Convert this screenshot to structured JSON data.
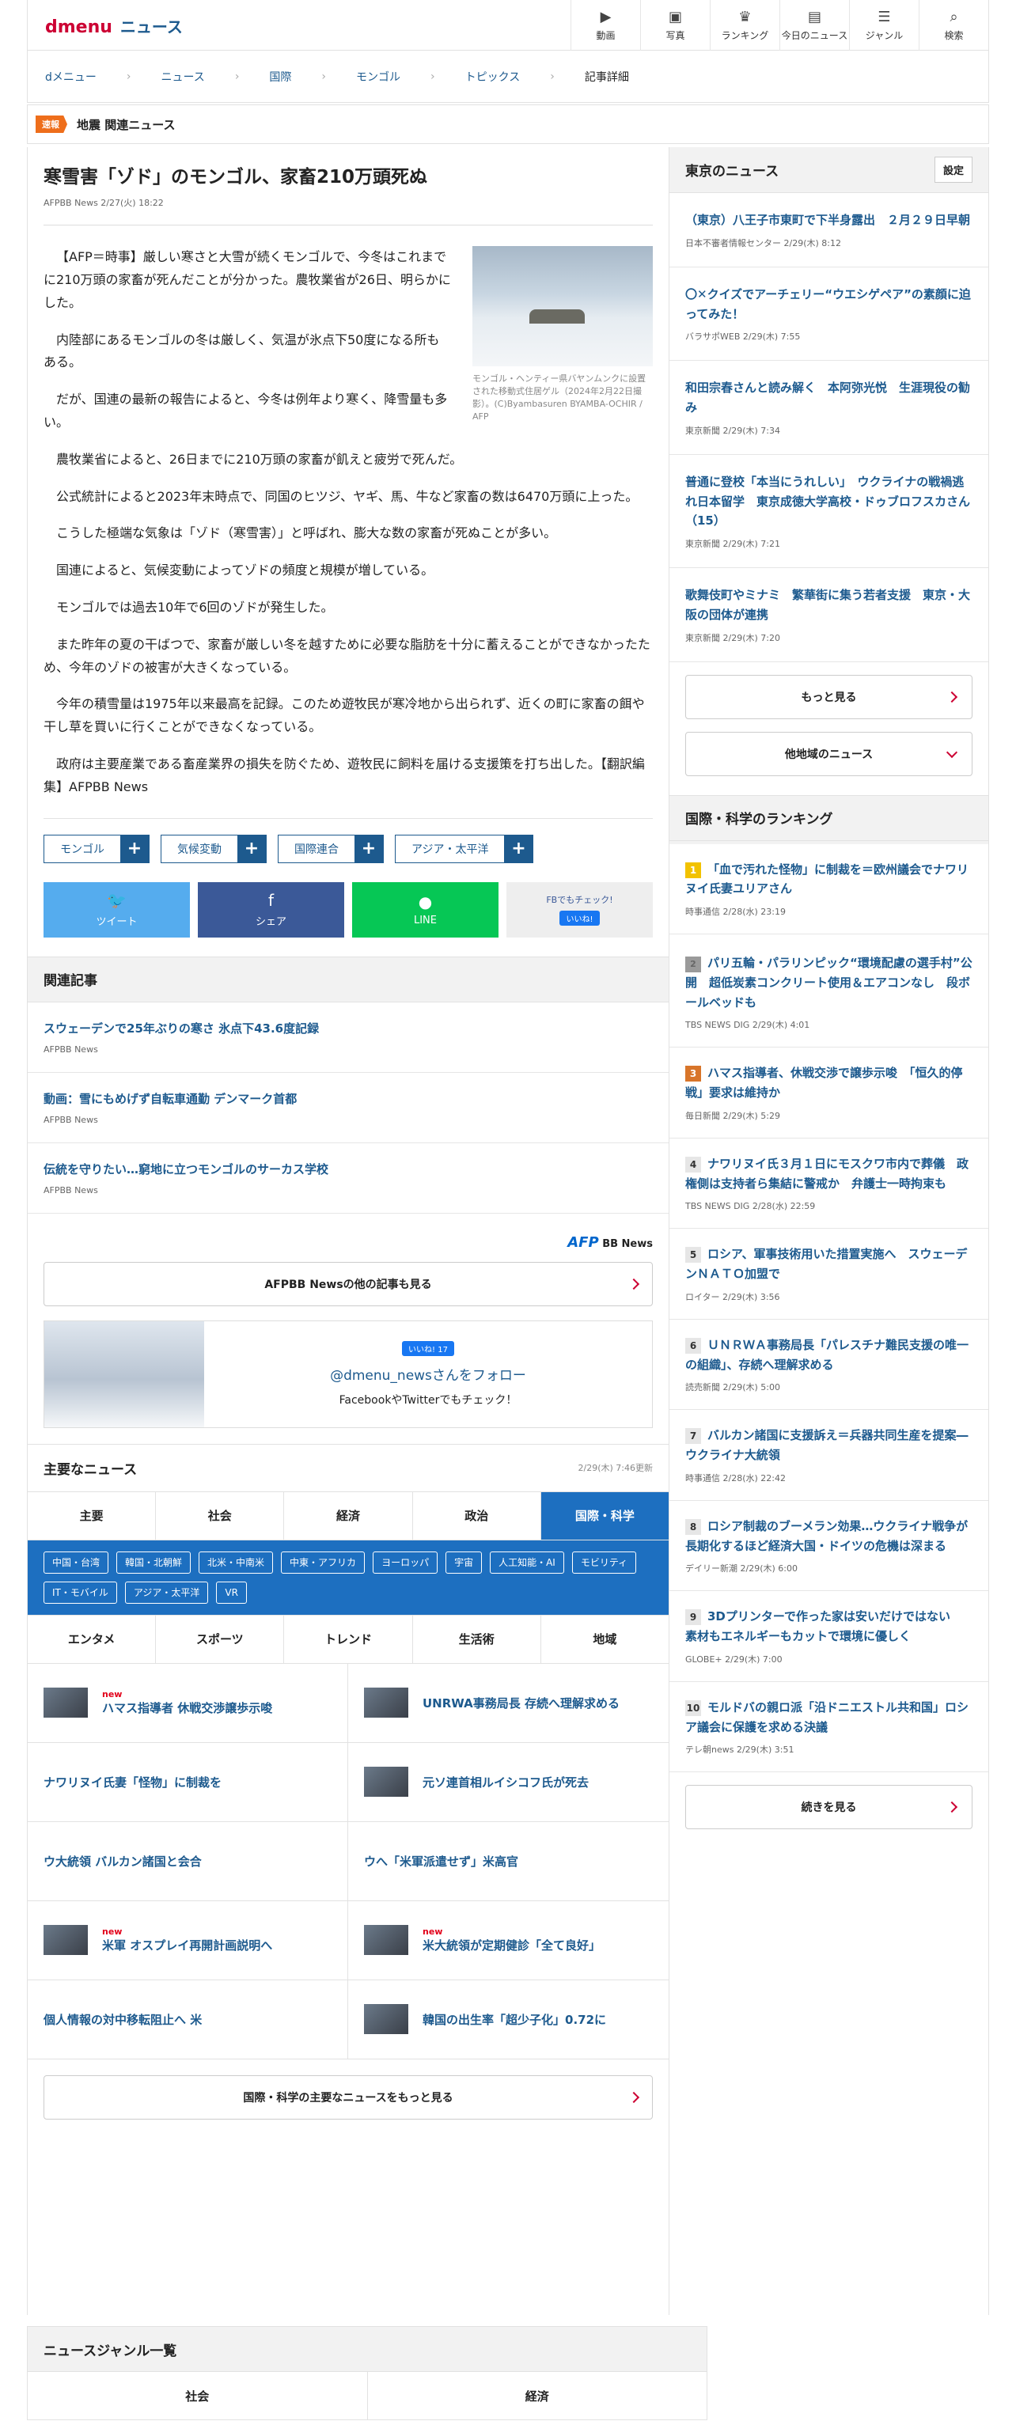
{
  "header": {
    "logo_d": "dmenu",
    "logo_news": "ニュース",
    "nav": [
      {
        "icon": "video-icon",
        "glyph": "▶",
        "label": "動画"
      },
      {
        "icon": "photo-icon",
        "glyph": "▣",
        "label": "写真"
      },
      {
        "icon": "ranking-icon",
        "glyph": "♛",
        "label": "ランキング"
      },
      {
        "icon": "today-icon",
        "glyph": "▤",
        "label": "今日のニュース"
      },
      {
        "icon": "genre-icon",
        "glyph": "☰",
        "label": "ジャンル"
      },
      {
        "icon": "search-icon",
        "glyph": "⌕",
        "label": "検索"
      }
    ]
  },
  "breadcrumb": [
    "dメニュー",
    "ニュース",
    "国際",
    "モンゴル",
    "トピックス",
    "記事詳細"
  ],
  "alert": {
    "badge": "速報",
    "text": "地震 関連ニュース"
  },
  "article": {
    "title": "寒雪害「ゾド」のモンゴル、家畜210万頭死ぬ",
    "meta": "AFPBB News 2/27(火) 18:22",
    "caption": "モンゴル・ヘンティー県バヤンムンクに設置された移動式住居ゲル（2024年2月22日撮影）。(C)Byambasuren BYAMBA-OCHIR / AFP",
    "paragraphs": [
      "【AFP＝時事】厳しい寒さと大雪が続くモンゴルで、今冬はこれまでに210万頭の家畜が死んだことが分かった。農牧業省が26日、明らかにした。",
      "内陸部にあるモンゴルの冬は厳しく、気温が氷点下50度になる所もある。",
      "だが、国連の最新の報告によると、今冬は例年より寒く、降雪量も多い。",
      "農牧業省によると、26日までに210万頭の家畜が飢えと疲労で死んだ。",
      "公式統計によると2023年末時点で、同国のヒツジ、ヤギ、馬、牛など家畜の数は6470万頭に上った。",
      "こうした極端な気象は「ゾド（寒雪害）」と呼ばれ、膨大な数の家畜が死ぬことが多い。",
      "国連によると、気候変動によってゾドの頻度と規模が増している。",
      "モンゴルでは過去10年で6回のゾドが発生した。",
      "また昨年の夏の干ばつで、家畜が厳しい冬を越すために必要な脂肪を十分に蓄えることができなかったため、今年のゾドの被害が大きくなっている。",
      "今年の積雪量は1975年以来最高を記録。このため遊牧民が寒冷地から出られず、近くの町に家畜の餌や干し草を買いに行くことができなくなっている。",
      "政府は主要産業である畜産業界の損失を防ぐため、遊牧民に飼料を届ける支援策を打ち出した。【翻訳編集】AFPBB News"
    ],
    "tags": [
      "モンゴル",
      "気候変動",
      "国際連合",
      "アジア・太平洋"
    ],
    "share": {
      "tweet": "ツイート",
      "share": "シェア",
      "line": "LINE",
      "fbcheck": "FBでもチェック!",
      "like": "いいね!"
    }
  },
  "related": {
    "heading": "関連記事",
    "items": [
      {
        "title": "スウェーデンで25年ぶりの寒さ 氷点下43.6度記録",
        "source": "AFPBB News"
      },
      {
        "title": "動画：雪にもめげず自転車通勤 デンマーク首都",
        "source": "AFPBB News"
      },
      {
        "title": "伝統を守りたい…窮地に立つモンゴルのサーカス学校",
        "source": "AFPBB News"
      }
    ],
    "afp_logo": "AFP",
    "afp_bb": "BB News",
    "more": "AFPBB Newsの他の記事も見る",
    "follow_like": "いいね! 17",
    "follow_handle": "@dmenu_newsさんをフォロー",
    "follow_sub": "FacebookやTwitterでもチェック！"
  },
  "main_news": {
    "heading": "主要なニュース",
    "updated": "2/29(木) 7:46更新",
    "tabs_top": [
      "主要",
      "社会",
      "経済",
      "政治",
      "国際・科学"
    ],
    "subcats": [
      "中国・台湾",
      "韓国・北朝鮮",
      "北米・中南米",
      "中東・アフリカ",
      "ヨーロッパ",
      "宇宙",
      "人工知能・AI",
      "モビリティ",
      "IT・モバイル",
      "アジア・太平洋",
      "VR"
    ],
    "tabs_bottom": [
      "エンタメ",
      "スポーツ",
      "トレンド",
      "生活術",
      "地域"
    ],
    "items": [
      {
        "title": "ハマス指導者 休戦交渉譲歩示唆",
        "new": "new",
        "thumb": true
      },
      {
        "title": "UNRWA事務局長 存続へ理解求める",
        "new": "",
        "thumb": true
      },
      {
        "title": "ナワリヌイ氏妻「怪物」に制裁を",
        "new": "",
        "thumb": false
      },
      {
        "title": "元ソ連首相ルイシコフ氏が死去",
        "new": "",
        "thumb": true
      },
      {
        "title": "ウ大統領 バルカン諸国と会合",
        "new": "",
        "thumb": false
      },
      {
        "title": "ウへ「米軍派遣せず」米高官",
        "new": "",
        "thumb": false
      },
      {
        "title": "米軍 オスプレイ再開計画説明へ",
        "new": "new",
        "thumb": true
      },
      {
        "title": "米大統領が定期健診「全て良好」",
        "new": "new",
        "thumb": true
      },
      {
        "title": "個人情報の対中移転阻止へ 米",
        "new": "",
        "thumb": false
      },
      {
        "title": "韓国の出生率「超少子化」0.72に",
        "new": "",
        "thumb": true
      }
    ],
    "more": "国際・科学の主要なニュースをもっと見る"
  },
  "tokyo": {
    "heading": "東京のニュース",
    "settings": "設定",
    "items": [
      {
        "title": "（東京）八王子市東町で下半身露出　２月２９日早朝",
        "source": "日本不審者情報センター 2/29(木) 8:12"
      },
      {
        "title": "〇✕クイズでアーチェリー“ウエシゲペア”の素顔に迫ってみた！",
        "source": "バラサポWEB 2/29(木) 7:55"
      },
      {
        "title": "和田宗春さんと読み解く　本阿弥光悦　生涯現役の勧み",
        "source": "東京新聞 2/29(木) 7:34"
      },
      {
        "title": "普通に登校「本当にうれしい」　ウクライナの戦禍逃れ日本留学　東京成徳大学高校・ドゥブロフスカさん（15）",
        "source": "東京新聞 2/29(木) 7:21"
      },
      {
        "title": "歌舞伎町やミナミ　繁華街に集う若者支援　東京・大阪の団体が連携",
        "source": "東京新聞 2/29(木) 7:20"
      }
    ],
    "more": "もっと見る",
    "other": "他地域のニュース"
  },
  "ranking": {
    "heading": "国際・科学のランキング",
    "items": [
      {
        "rank": "1",
        "title": "「血で汚れた怪物」に制裁を＝欧州議会でナワリヌイ氏妻ユリアさん",
        "source": "時事通信 2/28(水) 23:19"
      },
      {
        "rank": "2",
        "title": "パリ五輪・パラリンピック“環境配慮の選手村”公開　超低炭素コンクリート使用＆エアコンなし　段ボールベッドも",
        "source": "TBS NEWS DIG 2/29(木) 4:01"
      },
      {
        "rank": "3",
        "title": "ハマス指導者、休戦交渉で譲歩示唆　「恒久的停戦」要求は維持か",
        "source": "毎日新聞 2/29(木) 5:29"
      },
      {
        "rank": "4",
        "title": "ナワリヌイ氏３月１日にモスクワ市内で葬儀　政権側は支持者ら集結に警戒か　弁護士一時拘束も",
        "source": "TBS NEWS DIG 2/28(水) 22:59"
      },
      {
        "rank": "5",
        "title": "ロシア、軍事技術用いた措置実施へ　スウェーデンＮＡＴＯ加盟で",
        "source": "ロイター 2/29(木) 3:56"
      },
      {
        "rank": "6",
        "title": "ＵＮＲＷＡ事務局長「パレスチナ難民支援の唯一の組織」、存続へ理解求める",
        "source": "読売新聞 2/29(木) 5:00"
      },
      {
        "rank": "7",
        "title": "バルカン諸国に支援訴え＝兵器共同生産を提案―ウクライナ大統領",
        "source": "時事通信 2/28(水) 22:42"
      },
      {
        "rank": "8",
        "title": "ロシア制裁のブーメラン効果…ウクライナ戦争が長期化するほど経済大国・ドイツの危機は深まる",
        "source": "デイリー新潮 2/29(木) 6:00"
      },
      {
        "rank": "9",
        "title": "3Dプリンターで作った家は安いだけではない　素材もエネルギーもカットで環境に優しく",
        "source": "GLOBE+ 2/29(木) 7:00"
      },
      {
        "rank": "10",
        "title": "モルドバの親ロ派「沿ドニエストル共和国」ロシア議会に保護を求める決議",
        "source": "テレ朝news 2/29(木) 3:51"
      }
    ],
    "more": "続きを見る"
  },
  "genre": {
    "heading": "ニュースジャンル一覧",
    "items": [
      "社会",
      "経済"
    ]
  }
}
